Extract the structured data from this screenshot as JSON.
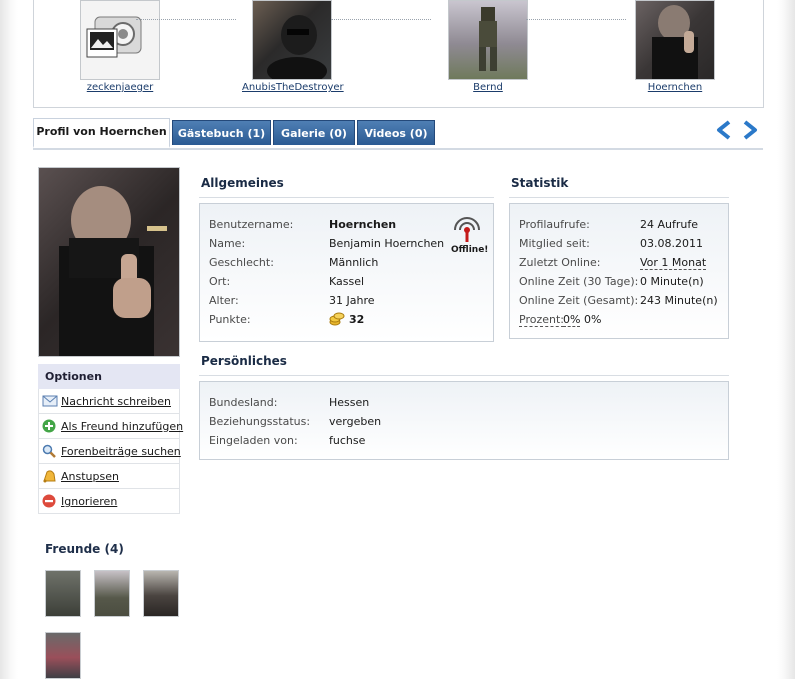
{
  "strip": {
    "friends": [
      {
        "name": "zeckenjaeger"
      },
      {
        "name": "AnubisTheDestroyer"
      },
      {
        "name": "Bernd"
      },
      {
        "name": "Hoernchen"
      }
    ]
  },
  "tabs": [
    {
      "label": "Profil von Hoernchen"
    },
    {
      "label": "Gästebuch (1)"
    },
    {
      "label": "Galerie (0)"
    },
    {
      "label": "Videos (0)"
    }
  ],
  "options": {
    "title": "Optionen",
    "items": [
      {
        "label": "Nachricht schreiben",
        "icon": "mail-icon"
      },
      {
        "label": "Als Freund hinzufügen",
        "icon": "add-icon"
      },
      {
        "label": "Forenbeiträge suchen",
        "icon": "search-icon"
      },
      {
        "label": "Anstupsen",
        "icon": "bell-icon"
      },
      {
        "label": "Ignorieren",
        "icon": "block-icon"
      }
    ]
  },
  "friends": {
    "title": "Freunde (4)"
  },
  "general": {
    "title": "Allgemeines",
    "status": "Offline!",
    "rows": [
      {
        "label": "Benutzername:",
        "value": "Hoernchen"
      },
      {
        "label": "Name:",
        "value": "Benjamin Hoernchen"
      },
      {
        "label": "Geschlecht:",
        "value": "Männlich"
      },
      {
        "label": "Ort:",
        "value": "Kassel"
      },
      {
        "label": "Alter:",
        "value": "31 Jahre"
      },
      {
        "label": "Punkte:",
        "value": "32"
      }
    ]
  },
  "stats": {
    "title": "Statistik",
    "rows": [
      {
        "label": "Profilaufrufe:",
        "value": "24 Aufrufe"
      },
      {
        "label": "Mitglied seit:",
        "value": "03.08.2011"
      },
      {
        "label": "Zuletzt Online:",
        "value": "Vor 1 Monat"
      },
      {
        "label": "Online Zeit (30 Tage):",
        "value": "0 Minute(n)"
      },
      {
        "label": "Online Zeit (Gesamt):",
        "value": "243 Minute(n)"
      }
    ],
    "percent_label": "Prozent:",
    "percent_a": "0%",
    "percent_b": "0%"
  },
  "personal": {
    "title": "Persönliches",
    "rows": [
      {
        "label": "Bundesland:",
        "value": "Hessen"
      },
      {
        "label": "Beziehungsstatus:",
        "value": "vergeben"
      },
      {
        "label": "Eingeladen von:",
        "value": "fuchse"
      }
    ]
  },
  "colors": {
    "tab": "#2a5a93",
    "link": "#1b3c6b",
    "arrow": "#2b79c9"
  }
}
